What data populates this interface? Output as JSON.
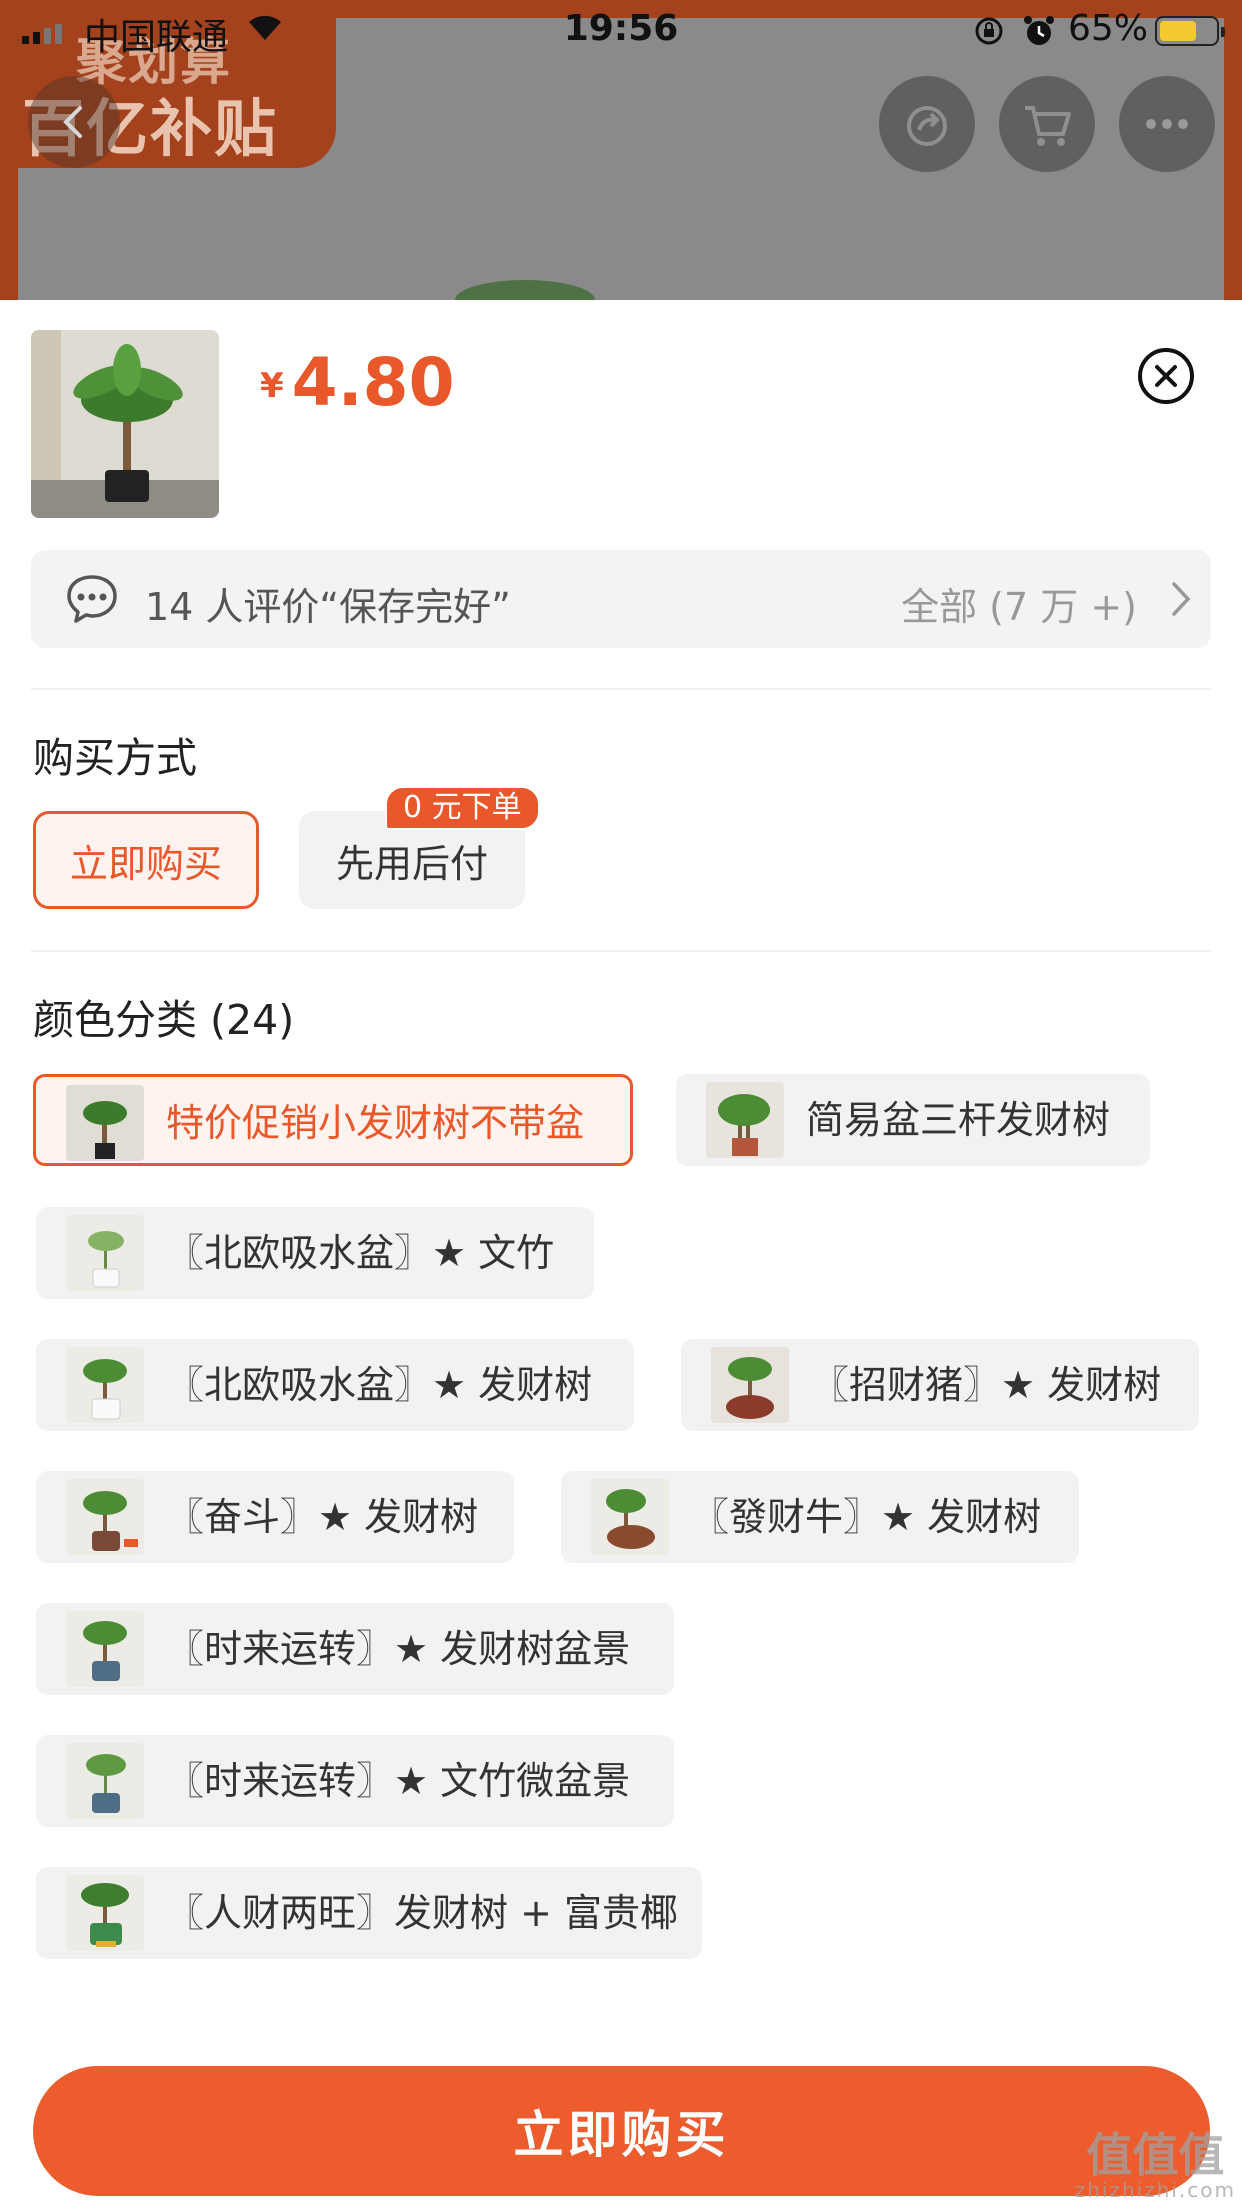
{
  "status_bar": {
    "carrier": "中国联通",
    "time": "19:56",
    "battery": "65%"
  },
  "promo": {
    "line1": "聚划算",
    "line2": "百亿补贴"
  },
  "product": {
    "price_symbol": "¥",
    "price": "4.80"
  },
  "review": {
    "text": "14 人评价“保存完好”",
    "all": "全部 (7 万 +)"
  },
  "purchase": {
    "title": "购买方式",
    "options": [
      {
        "label": "立即购买",
        "selected": true
      },
      {
        "label": "先用后付",
        "selected": false
      }
    ],
    "badge": "0 元下单"
  },
  "colors": {
    "title": "颜色分类 (24)",
    "items": [
      {
        "label": "特价促销小发财树不带盆",
        "selected": true
      },
      {
        "label": "简易盆三杆发财树",
        "selected": false
      },
      {
        "label": "〖北欧吸水盆〗★ 文竹",
        "selected": false
      },
      {
        "label": "〖北欧吸水盆〗★ 发财树",
        "selected": false
      },
      {
        "label": "〖招财猪〗★ 发财树",
        "selected": false
      },
      {
        "label": "〖奋斗〗★ 发财树",
        "selected": false
      },
      {
        "label": "〖發财牛〗★ 发财树",
        "selected": false
      },
      {
        "label": "〖时来运转〗★ 发财树盆景",
        "selected": false
      },
      {
        "label": "〖时来运转〗★ 文竹微盆景",
        "selected": false
      },
      {
        "label": "〖人财两旺〗发财树 + 富贵椰",
        "selected": false
      }
    ]
  },
  "buy_button": "立即购买",
  "watermark": {
    "text": "值值值",
    "url": "zhizhizhi.com"
  },
  "theme": {
    "accent": "#e8582a",
    "chip_bg": "#f2f2f2",
    "selected_bg": "#fff3ef"
  }
}
